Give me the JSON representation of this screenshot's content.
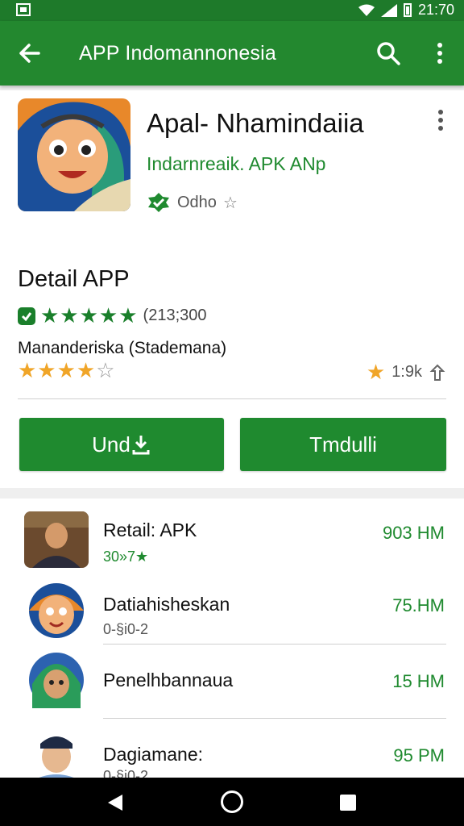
{
  "status_bar": {
    "time": "21:70"
  },
  "app_bar": {
    "title": "APP Indomannonesia"
  },
  "app": {
    "name": "Apal- Nhamindaiia",
    "developer": "Indarnreaik. APK ANp",
    "badge_text": "Odho"
  },
  "detail": {
    "section_title": "Detail  APP",
    "rating_count": "(213;300",
    "sub_label": "Mananderiska (Stademana)",
    "right_count": "1:9k"
  },
  "buttons": {
    "primary_label": "Und",
    "secondary_label": "Tmdulli"
  },
  "list": [
    {
      "title": "Retail: APK",
      "subtitle": "30»7★",
      "size": "903 HM"
    },
    {
      "title": "Datiahisheskan",
      "subtitle": "0-§i0-2",
      "size": "75.HM"
    },
    {
      "title": "Penelhbannaua",
      "subtitle": "",
      "size": "15 HM"
    },
    {
      "title": "Dagiamane:",
      "subtitle": "0-§i0-2",
      "size": "95 PM"
    }
  ],
  "colors": {
    "primary_green": "#23882f",
    "status_green": "#1e7a2a",
    "star_orange": "#f0a528"
  },
  "icons": [
    "back-arrow-icon",
    "search-icon",
    "more-vert-icon",
    "verified-badge-icon",
    "star-icon",
    "share-icon",
    "download-icon",
    "nav-back-icon",
    "nav-home-icon",
    "nav-recents-icon"
  ]
}
